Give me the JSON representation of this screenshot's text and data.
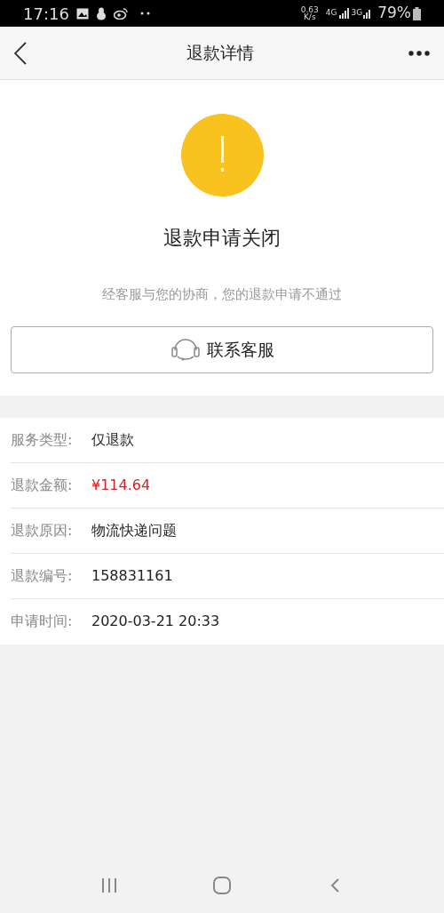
{
  "status_bar": {
    "time": "17:16",
    "speed_value": "0.63",
    "speed_unit": "K/s",
    "network_1": "4G",
    "network_2": "3G",
    "battery": "79%"
  },
  "header": {
    "title": "退款详情"
  },
  "result": {
    "title": "退款申请关闭",
    "message": "经客服与您的协商，您的退款申请不通过",
    "button": "联系客服"
  },
  "details": [
    {
      "label": "服务类型:",
      "value": "仅退款",
      "kind": "text"
    },
    {
      "label": "退款金额:",
      "value": "¥114.64",
      "kind": "amount"
    },
    {
      "label": "退款原因:",
      "value": "物流快递问题",
      "kind": "text"
    },
    {
      "label": "退款编号:",
      "value": "158831161",
      "kind": "text"
    },
    {
      "label": "申请时间:",
      "value": "2020-03-21 20:33",
      "kind": "text"
    }
  ]
}
